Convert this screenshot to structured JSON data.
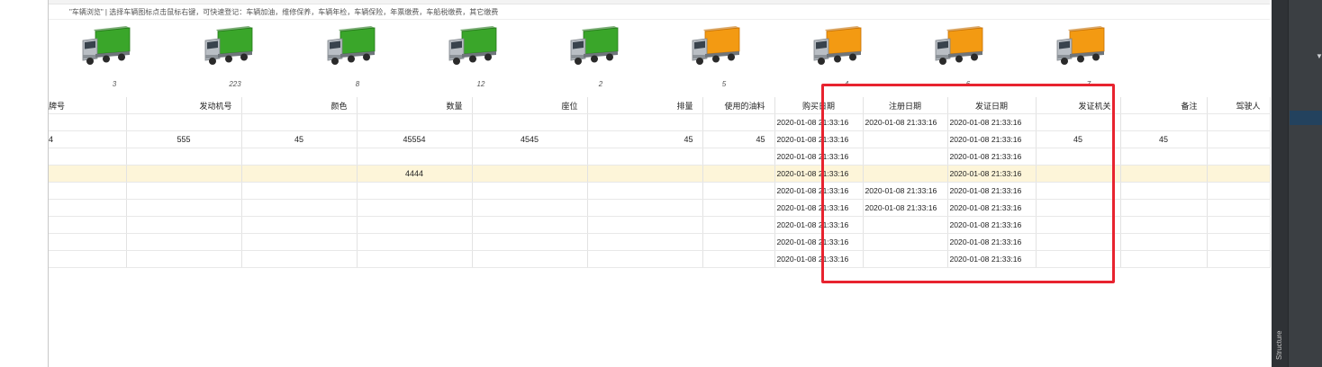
{
  "hint": "\"车辆浏览\" | 选择车辆图标点击鼠标右键，可快速登记：车辆加油，维修保养，车辆年检，车辆保险，年票缴费，车船税缴费，其它缴费",
  "vehicle_icons": [
    {
      "color": "green",
      "count": "3"
    },
    {
      "color": "green",
      "count": "223"
    },
    {
      "color": "green",
      "count": "8"
    },
    {
      "color": "green",
      "count": "12"
    },
    {
      "color": "green",
      "count": "2"
    },
    {
      "color": "orange",
      "count": "5"
    },
    {
      "color": "orange",
      "count": "4"
    },
    {
      "color": "orange",
      "count": "6"
    },
    {
      "color": "orange",
      "count": "7"
    }
  ],
  "colors": {
    "green_cargo": "#3aa62a",
    "orange_cargo": "#f39a12",
    "highlight": "#e8232f",
    "selected_row": "#fdf5d9"
  },
  "table": {
    "headers": [
      "牌号",
      "发动机号",
      "颜色",
      "数量",
      "座位",
      "排量",
      "使用的油料",
      "购买日期",
      "注册日期",
      "发证日期",
      "发证机关",
      "备注",
      "驾驶人"
    ],
    "rows": [
      [
        "",
        "",
        "",
        "",
        "",
        "",
        "",
        "2020-01-08 21:33:16",
        "2020-01-08 21:33:16",
        "2020-01-08 21:33:16",
        "",
        "",
        ""
      ],
      [
        "4",
        "555",
        "45",
        "45554",
        "4545",
        "45",
        "45",
        "2020-01-08 21:33:16",
        "",
        "2020-01-08 21:33:16",
        "45",
        "45",
        ""
      ],
      [
        "",
        "",
        "",
        "",
        "",
        "",
        "",
        "2020-01-08 21:33:16",
        "",
        "2020-01-08 21:33:16",
        "",
        "",
        ""
      ],
      [
        "",
        "",
        "",
        "4444",
        "",
        "",
        "",
        "2020-01-08 21:33:16",
        "",
        "2020-01-08 21:33:16",
        "",
        "",
        ""
      ],
      [
        "",
        "",
        "",
        "",
        "",
        "",
        "",
        "2020-01-08 21:33:16",
        "2020-01-08 21:33:16",
        "2020-01-08 21:33:16",
        "",
        "",
        ""
      ],
      [
        "",
        "",
        "",
        "",
        "",
        "",
        "",
        "2020-01-08 21:33:16",
        "2020-01-08 21:33:16",
        "2020-01-08 21:33:16",
        "",
        "",
        ""
      ],
      [
        "",
        "",
        "",
        "",
        "",
        "",
        "",
        "2020-01-08 21:33:16",
        "",
        "2020-01-08 21:33:16",
        "",
        "",
        ""
      ],
      [
        "",
        "",
        "",
        "",
        "",
        "",
        "",
        "2020-01-08 21:33:16",
        "",
        "2020-01-08 21:33:16",
        "",
        "",
        ""
      ],
      [
        "",
        "",
        "",
        "",
        "",
        "",
        "",
        "2020-01-08 21:33:16",
        "",
        "2020-01-08 21:33:16",
        "",
        "",
        ""
      ]
    ],
    "selected_row": 3
  },
  "side_panel": {
    "label": "Structure"
  }
}
